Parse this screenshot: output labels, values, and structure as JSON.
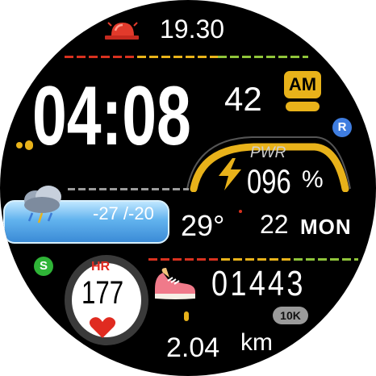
{
  "alarm": {
    "time": "19.30",
    "icon": "alarm-siren-icon"
  },
  "time": {
    "hours_minutes": "04:08",
    "seconds": "42",
    "ampm": "AM"
  },
  "badges": {
    "r": "R",
    "s": "S"
  },
  "power": {
    "label": "PWR",
    "value": "096",
    "unit": "%",
    "icon": "lightning-bolt-icon",
    "level_percent": 96
  },
  "weather": {
    "range": "-27 /-20",
    "temperature": "29°",
    "icon": "rain-cloud-icon"
  },
  "date": {
    "day": "22",
    "weekday": "MON"
  },
  "heart_rate": {
    "label": "HR",
    "value": "177",
    "icon": "heart-icon"
  },
  "steps": {
    "count": "01443",
    "goal": "10K",
    "icon": "sneaker-icon"
  },
  "distance": {
    "value": "2.04",
    "unit": "km"
  },
  "colors": {
    "accent_yellow": "#e8b21a",
    "accent_red": "#d8311f",
    "accent_green": "#8fc43a",
    "badge_blue": "#3f7de0",
    "badge_green": "#2fb437",
    "water_blue": "#4a9ee0"
  }
}
